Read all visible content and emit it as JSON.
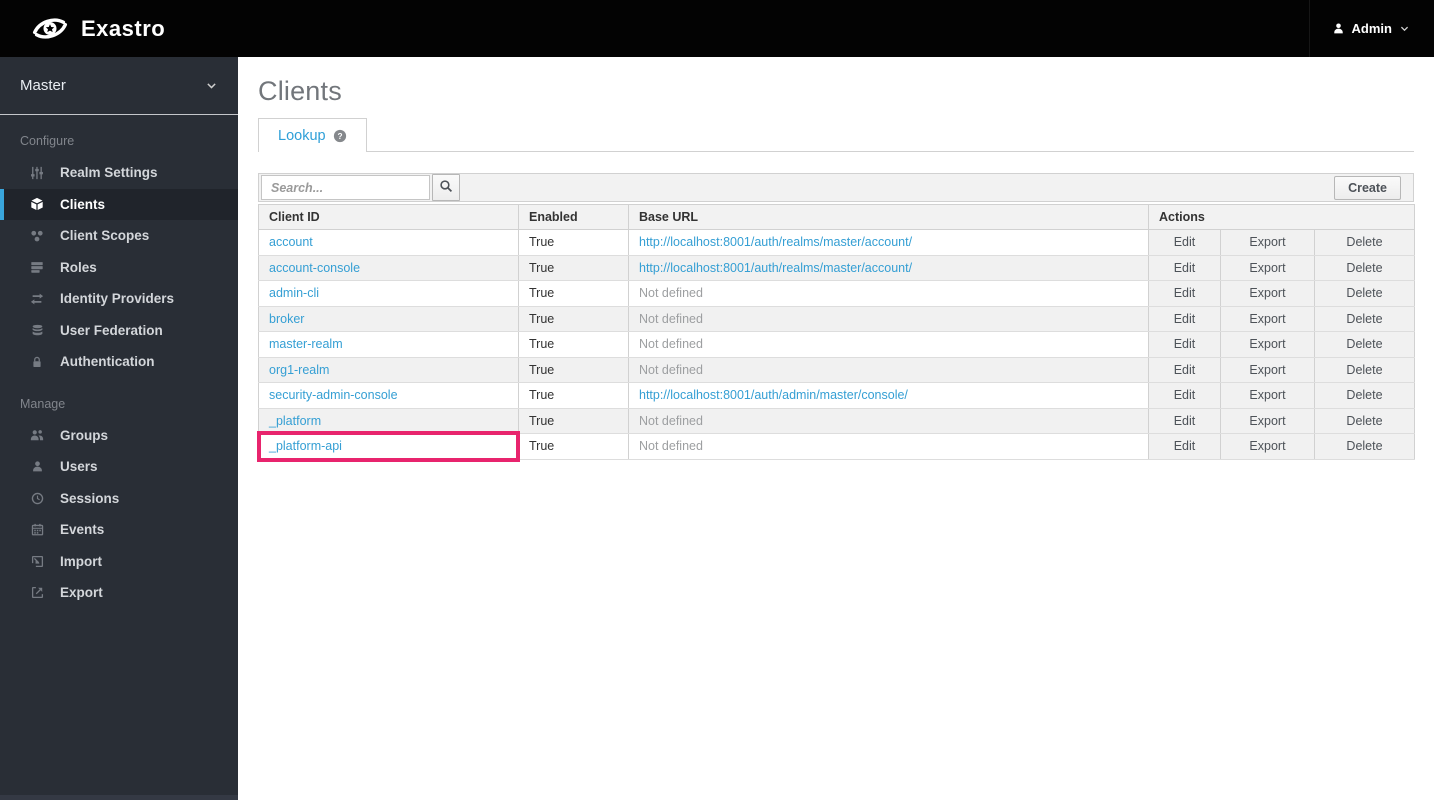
{
  "header": {
    "brand": "Exastro",
    "user_label": "Admin"
  },
  "sidebar": {
    "realm_selector": "Master",
    "sections": [
      {
        "label": "Configure",
        "items": [
          {
            "label": "Realm Settings",
            "icon": "sliders-icon",
            "active": false
          },
          {
            "label": "Clients",
            "icon": "cube-icon",
            "active": true
          },
          {
            "label": "Client Scopes",
            "icon": "client-scopes-icon",
            "active": false
          },
          {
            "label": "Roles",
            "icon": "roles-icon",
            "active": false
          },
          {
            "label": "Identity Providers",
            "icon": "exchange-icon",
            "active": false
          },
          {
            "label": "User Federation",
            "icon": "database-icon",
            "active": false
          },
          {
            "label": "Authentication",
            "icon": "lock-icon",
            "active": false
          }
        ]
      },
      {
        "label": "Manage",
        "items": [
          {
            "label": "Groups",
            "icon": "groups-icon",
            "active": false
          },
          {
            "label": "Users",
            "icon": "user-icon",
            "active": false
          },
          {
            "label": "Sessions",
            "icon": "clock-icon",
            "active": false
          },
          {
            "label": "Events",
            "icon": "calendar-icon",
            "active": false
          },
          {
            "label": "Import",
            "icon": "import-icon",
            "active": false
          },
          {
            "label": "Export",
            "icon": "export-icon",
            "active": false
          }
        ]
      }
    ]
  },
  "main": {
    "title": "Clients",
    "tab": {
      "label": "Lookup"
    },
    "toolbar": {
      "search_placeholder": "Search...",
      "create_label": "Create"
    },
    "table": {
      "columns": [
        "Client ID",
        "Enabled",
        "Base URL",
        "Actions"
      ],
      "action_labels": [
        "Edit",
        "Export",
        "Delete"
      ],
      "rows": [
        {
          "client_id": "account",
          "enabled": "True",
          "base_url": "http://localhost:8001/auth/realms/master/account/",
          "url_defined": true,
          "highlighted": false
        },
        {
          "client_id": "account-console",
          "enabled": "True",
          "base_url": "http://localhost:8001/auth/realms/master/account/",
          "url_defined": true,
          "highlighted": false
        },
        {
          "client_id": "admin-cli",
          "enabled": "True",
          "base_url": "Not defined",
          "url_defined": false,
          "highlighted": false
        },
        {
          "client_id": "broker",
          "enabled": "True",
          "base_url": "Not defined",
          "url_defined": false,
          "highlighted": false
        },
        {
          "client_id": "master-realm",
          "enabled": "True",
          "base_url": "Not defined",
          "url_defined": false,
          "highlighted": false
        },
        {
          "client_id": "org1-realm",
          "enabled": "True",
          "base_url": "Not defined",
          "url_defined": false,
          "highlighted": false
        },
        {
          "client_id": "security-admin-console",
          "enabled": "True",
          "base_url": "http://localhost:8001/auth/admin/master/console/",
          "url_defined": true,
          "highlighted": false
        },
        {
          "client_id": "_platform",
          "enabled": "True",
          "base_url": "Not defined",
          "url_defined": false,
          "highlighted": false
        },
        {
          "client_id": "_platform-api",
          "enabled": "True",
          "base_url": "Not defined",
          "url_defined": false,
          "highlighted": true
        }
      ]
    }
  },
  "colors": {
    "highlight_border": "#e8246d",
    "link_blue": "#359fd4",
    "active_nav_bar": "#39a5dc",
    "sidebar_bg": "#292e36",
    "header_bg": "#030303"
  }
}
